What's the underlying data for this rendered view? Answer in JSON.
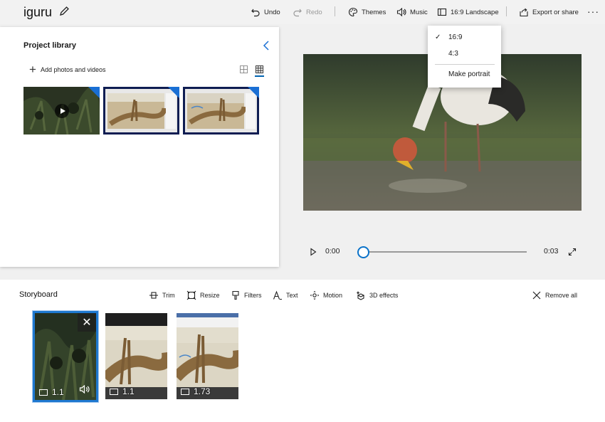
{
  "app": {
    "title": "iguru"
  },
  "toolbar": {
    "undo": "Undo",
    "redo": "Redo",
    "themes": "Themes",
    "music": "Music",
    "aspect": "16:9 Landscape",
    "export": "Export or share",
    "more": "···"
  },
  "library": {
    "title": "Project library",
    "add_label": "Add photos and videos"
  },
  "aspect_menu": {
    "items": [
      "16:9",
      "4:3",
      "Make portrait"
    ],
    "selected": "16:9",
    "check": "✓"
  },
  "player": {
    "current_time": "0:00",
    "total_time": "0:03",
    "progress": 0.0
  },
  "storyboard": {
    "title": "Storyboard",
    "tools": {
      "trim": "Trim",
      "resize": "Resize",
      "filters": "Filters",
      "text": "Text",
      "motion": "Motion",
      "effects3d": "3D effects",
      "remove_all": "Remove all"
    },
    "cards": [
      {
        "duration": "1.1",
        "selected": true
      },
      {
        "duration": "1.1",
        "selected": false
      },
      {
        "duration": "1.73",
        "selected": false
      }
    ],
    "close_glyph": "✕"
  },
  "colors": {
    "accent": "#0063b1",
    "selection": "#1e78d0",
    "corner_badge": "#1a6fd4"
  }
}
